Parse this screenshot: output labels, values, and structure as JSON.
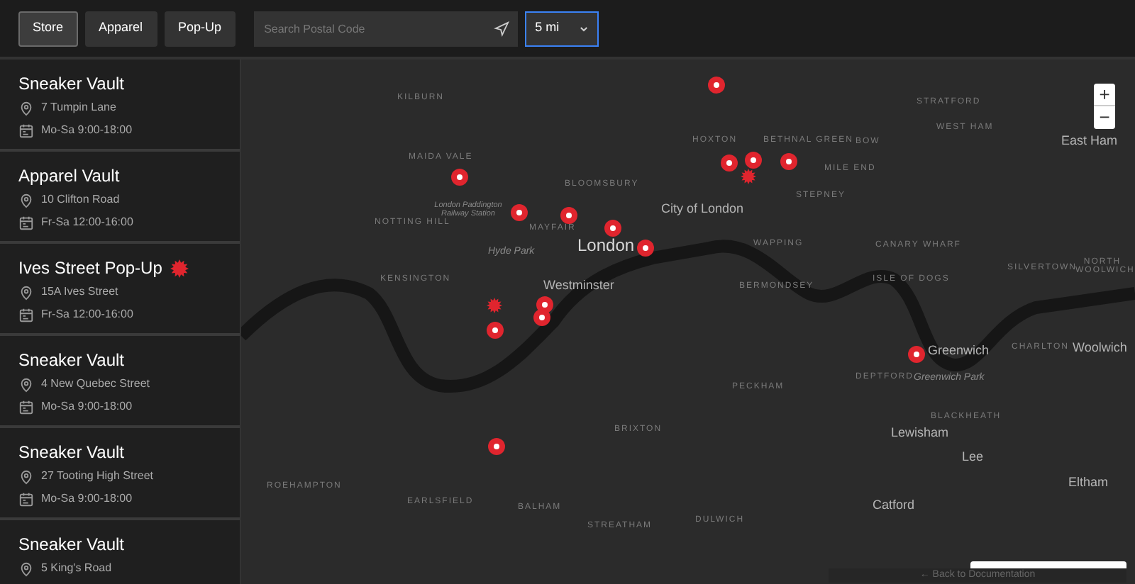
{
  "filters": [
    {
      "label": "Store",
      "selected": true
    },
    {
      "label": "Apparel",
      "selected": false
    },
    {
      "label": "Pop-Up",
      "selected": false
    }
  ],
  "search": {
    "placeholder": "Search Postal Code"
  },
  "distance": {
    "value": "5 mi",
    "focused": true
  },
  "stores": [
    {
      "name": "Sneaker Vault",
      "address": "7 Tumpin Lane",
      "hours": "Mo-Sa 9:00-18:00",
      "kind": "store"
    },
    {
      "name": "Apparel Vault",
      "address": "10 Clifton Road",
      "hours": "Fr-Sa 12:00-16:00",
      "kind": "store"
    },
    {
      "name": "Ives Street Pop-Up",
      "address": "15A Ives Street",
      "hours": "Fr-Sa 12:00-16:00",
      "kind": "popup"
    },
    {
      "name": "Sneaker Vault",
      "address": "4 New Quebec Street",
      "hours": "Mo-Sa 9:00-18:00",
      "kind": "store"
    },
    {
      "name": "Sneaker Vault",
      "address": "27 Tooting High Street",
      "hours": "Mo-Sa 9:00-18:00",
      "kind": "store"
    },
    {
      "name": "Sneaker Vault",
      "address": "5 King's Road",
      "kind": "store"
    }
  ],
  "map": {
    "labels": [
      {
        "text": "KILBURN",
        "kind": "area"
      },
      {
        "text": "STRATFORD",
        "kind": "area"
      },
      {
        "text": "WEST HAM",
        "kind": "area"
      },
      {
        "text": "HOXTON",
        "kind": "area"
      },
      {
        "text": "BETHNAL GREEN",
        "kind": "area"
      },
      {
        "text": "BOW",
        "kind": "area"
      },
      {
        "text": "East Ham",
        "kind": "town"
      },
      {
        "text": "MAIDA VALE",
        "kind": "area"
      },
      {
        "text": "MILE END",
        "kind": "area"
      },
      {
        "text": "BLOOMSBURY",
        "kind": "area"
      },
      {
        "text": "STEPNEY",
        "kind": "area"
      },
      {
        "text": "London Paddington Railway Station",
        "kind": "station"
      },
      {
        "text": "City of London",
        "kind": "town"
      },
      {
        "text": "NOTTING HILL",
        "kind": "area"
      },
      {
        "text": "MAYFAIR",
        "kind": "area"
      },
      {
        "text": "Hyde Park",
        "kind": "park"
      },
      {
        "text": "London",
        "kind": "major"
      },
      {
        "text": "WAPPING",
        "kind": "area"
      },
      {
        "text": "CANARY WHARF",
        "kind": "area"
      },
      {
        "text": "KENSINGTON",
        "kind": "area"
      },
      {
        "text": "Westminster",
        "kind": "town"
      },
      {
        "text": "BERMONDSEY",
        "kind": "area"
      },
      {
        "text": "ISLE OF DOGS",
        "kind": "area"
      },
      {
        "text": "SILVERTOWN",
        "kind": "area"
      },
      {
        "text": "NORTH WOOLWICH",
        "kind": "stacked"
      },
      {
        "text": "Greenwich",
        "kind": "town"
      },
      {
        "text": "CHARLTON",
        "kind": "area"
      },
      {
        "text": "Woolwich",
        "kind": "town"
      },
      {
        "text": "DEPTFORD",
        "kind": "area"
      },
      {
        "text": "Greenwich Park",
        "kind": "park"
      },
      {
        "text": "PECKHAM",
        "kind": "area"
      },
      {
        "text": "BLACKHEATH",
        "kind": "area"
      },
      {
        "text": "BRIXTON",
        "kind": "area"
      },
      {
        "text": "Lewisham",
        "kind": "town"
      },
      {
        "text": "Lee",
        "kind": "town"
      },
      {
        "text": "ROEHAMPTON",
        "kind": "area"
      },
      {
        "text": "Eltham",
        "kind": "town"
      },
      {
        "text": "EARLSFIELD",
        "kind": "area"
      },
      {
        "text": "BALHAM",
        "kind": "area"
      },
      {
        "text": "Catford",
        "kind": "town"
      },
      {
        "text": "STREATHAM",
        "kind": "area"
      },
      {
        "text": "DULWICH",
        "kind": "area"
      }
    ],
    "markers": [
      {
        "kind": "dot"
      },
      {
        "kind": "dot"
      },
      {
        "kind": "dot"
      },
      {
        "kind": "dot"
      },
      {
        "kind": "dot"
      },
      {
        "kind": "dot"
      },
      {
        "kind": "dot"
      },
      {
        "kind": "dot"
      },
      {
        "kind": "dot"
      },
      {
        "kind": "dot"
      },
      {
        "kind": "dot"
      },
      {
        "kind": "dot"
      },
      {
        "kind": "dot"
      },
      {
        "kind": "dot"
      },
      {
        "kind": "burst"
      },
      {
        "kind": "burst"
      }
    ],
    "zoom": {
      "in": "+",
      "out": "−"
    },
    "back_link": "← Back to Documentation"
  }
}
